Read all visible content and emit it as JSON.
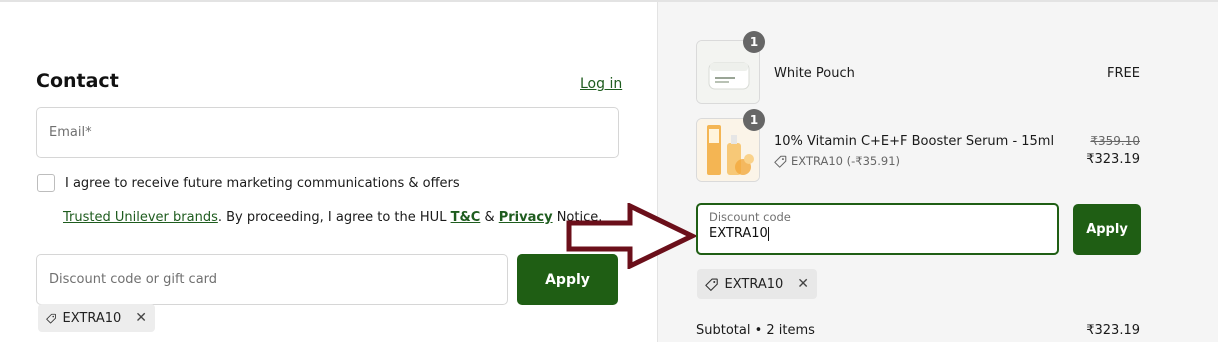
{
  "contact": {
    "title": "Contact",
    "login_link": "Log in",
    "email_placeholder": "Email*",
    "marketing_label": "I agree to receive future marketing communications & offers",
    "consent": {
      "brands_link": "Trusted Unilever brands",
      "text_1": ". By proceeding, I agree to the HUL ",
      "tc_link": "T&C",
      "text_2": " & ",
      "privacy_link": "Privacy",
      "text_3": " Notice."
    },
    "discount_placeholder": "Discount code or gift card",
    "apply_label": "Apply",
    "applied_code": "EXTRA10"
  },
  "order_summary": {
    "items": [
      {
        "quantity": "1",
        "name": "White Pouch",
        "price": "FREE"
      },
      {
        "quantity": "1",
        "name": "10% Vitamin C+E+F Booster Serum - 15ml",
        "discount": "EXTRA10 (-₹35.91)",
        "original_price": "₹359.10",
        "price": "₹323.19"
      }
    ],
    "discount_label": "Discount code",
    "discount_value": "EXTRA10",
    "apply_label": "Apply",
    "applied_code": "EXTRA10",
    "subtotal_label": "Subtotal • 2 items",
    "subtotal_value": "₹323.19"
  },
  "colors": {
    "brand_green": "#1f5e14",
    "annotation_arrow": "#6b0f1a"
  },
  "icons": [
    "tag-icon",
    "close-icon",
    "arrow-right-icon"
  ]
}
